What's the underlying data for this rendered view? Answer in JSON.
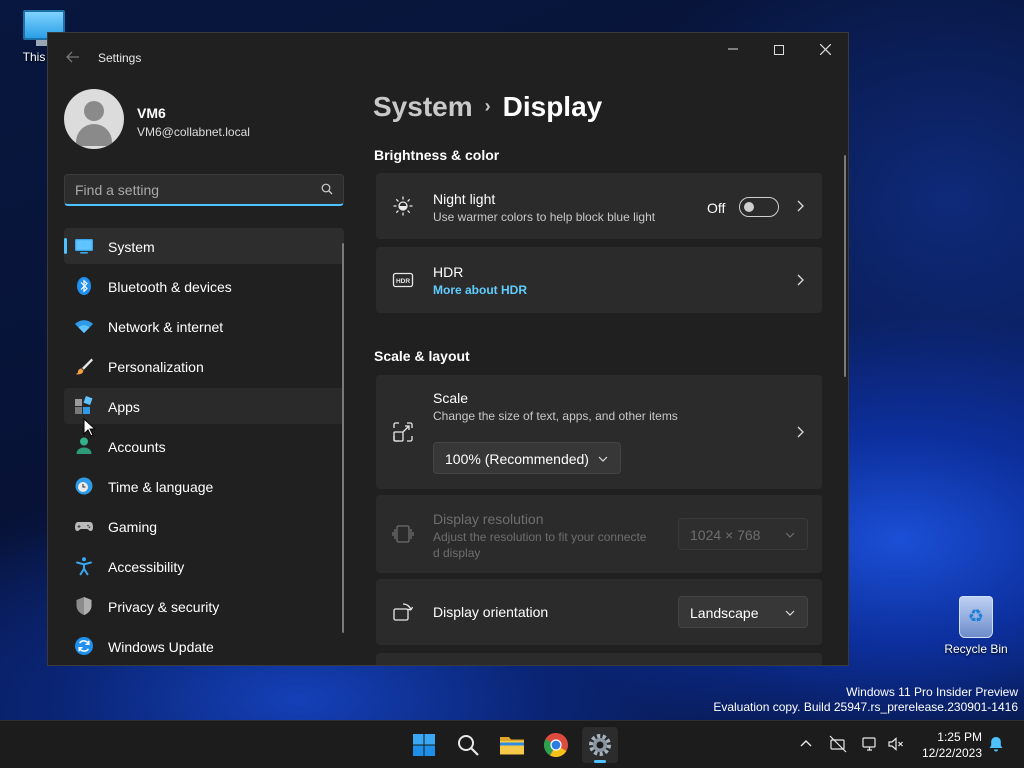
{
  "desktop": {
    "this_pc_label": "This PC",
    "recycle_bin_label": "Recycle Bin",
    "watermark": {
      "line1": "Windows 11 Pro Insider Preview",
      "line2": "Evaluation copy. Build 25947.rs_prerelease.230901-1416"
    }
  },
  "window": {
    "title": "Settings",
    "controls": {
      "minimize": "—",
      "close": "✕"
    }
  },
  "profile": {
    "name": "VM6",
    "email": "VM6@collabnet.local"
  },
  "search": {
    "placeholder": "Find a setting",
    "value": ""
  },
  "nav": {
    "items": [
      {
        "label": "System",
        "icon": "monitor-icon",
        "state": "selected"
      },
      {
        "label": "Bluetooth & devices",
        "icon": "bluetooth-icon"
      },
      {
        "label": "Network & internet",
        "icon": "wifi-icon"
      },
      {
        "label": "Personalization",
        "icon": "brush-icon"
      },
      {
        "label": "Apps",
        "icon": "apps-icon",
        "state": "hover"
      },
      {
        "label": "Accounts",
        "icon": "person-icon"
      },
      {
        "label": "Time & language",
        "icon": "globe-clock-icon"
      },
      {
        "label": "Gaming",
        "icon": "gamepad-icon"
      },
      {
        "label": "Accessibility",
        "icon": "accessibility-icon"
      },
      {
        "label": "Privacy & security",
        "icon": "shield-icon"
      },
      {
        "label": "Windows Update",
        "icon": "update-icon"
      }
    ]
  },
  "breadcrumb": {
    "parent": "System",
    "separator": "›",
    "current": "Display"
  },
  "sections": {
    "brightness_color": "Brightness & color",
    "scale_layout": "Scale & layout"
  },
  "night_light": {
    "title": "Night light",
    "description": "Use warmer colors to help block blue light",
    "toggle_state_label": "Off",
    "enabled": false
  },
  "hdr": {
    "title": "HDR",
    "link": "More about HDR"
  },
  "scale": {
    "title": "Scale",
    "description": "Change the size of text, apps, and other items",
    "selected": "100% (Recommended)"
  },
  "resolution": {
    "title": "Display resolution",
    "description_line1": "Adjust the resolution to fit your connecte",
    "description_line2": "d display",
    "selected": "1024 × 768",
    "disabled": true
  },
  "orientation": {
    "title": "Display orientation",
    "selected": "Landscape"
  },
  "taskbar": {
    "apps": [
      "start-icon",
      "search-icon",
      "file-explorer-icon",
      "chrome-icon",
      "settings-icon"
    ],
    "clock": {
      "time": "1:25 PM",
      "date": "12/22/2023"
    }
  },
  "colors": {
    "accent": "#4cc2ff",
    "link": "#60cdff",
    "window_bg": "#202020",
    "card_bg": "#2b2b2b"
  }
}
